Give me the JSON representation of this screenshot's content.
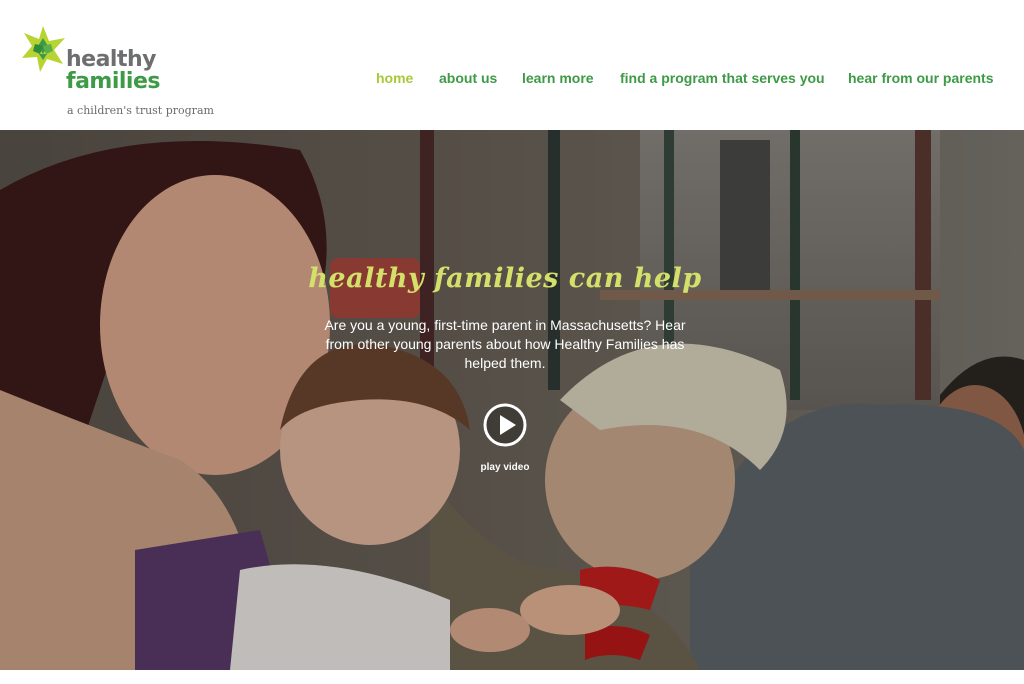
{
  "brand": {
    "name_line1": "healthy",
    "name_line2": "families",
    "tagline": "a children's trust program",
    "colors": {
      "gray": "#6d6e70",
      "green": "#3d9a46",
      "star_light": "#b7d433",
      "star_dark": "#3e9a47"
    }
  },
  "nav": {
    "items": [
      {
        "label": "home",
        "active": true
      },
      {
        "label": "about us",
        "active": false
      },
      {
        "label": "learn more",
        "active": false
      },
      {
        "label": "find a program that serves you",
        "active": false
      },
      {
        "label": "hear from our parents",
        "active": false
      }
    ],
    "active_color": "#a8c93a",
    "color": "#3d9a46"
  },
  "hero": {
    "title": "healthy families can help",
    "title_color": "#d4e06a",
    "text": "Are you a young, first-time parent in Massachusetts? Hear from other young parents about how Healthy Families has helped them.",
    "play_label": "play video",
    "image_desc_icon": "play-icon"
  }
}
